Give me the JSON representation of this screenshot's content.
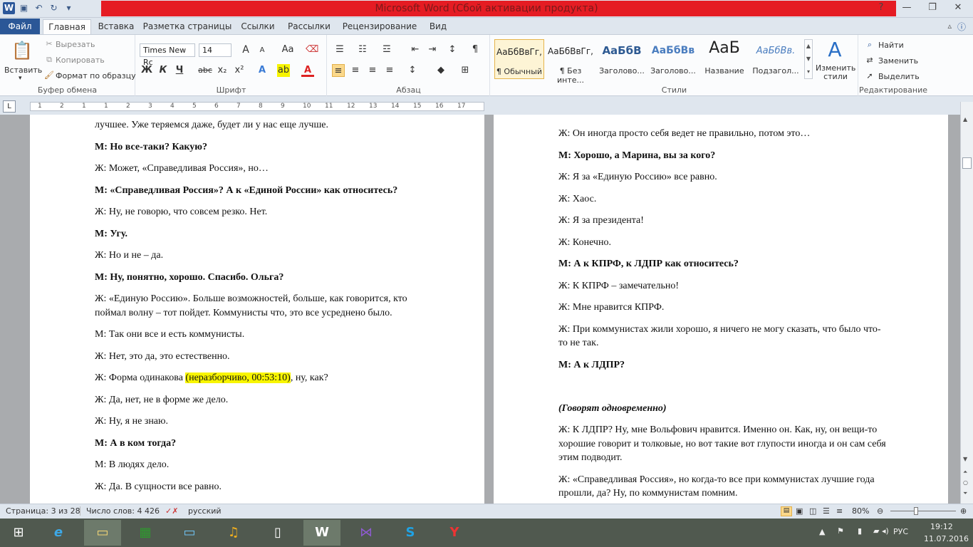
{
  "window": {
    "title": "Microsoft Word (Сбой активации продукта)"
  },
  "qat": {
    "word_icon": "W",
    "save_icon": "save-icon",
    "undo_icon": "undo-icon",
    "redo_icon": "redo-icon"
  },
  "tabs": [
    "Файл",
    "Главная",
    "Вставка",
    "Разметка страницы",
    "Ссылки",
    "Рассылки",
    "Рецензирование",
    "Вид"
  ],
  "clipboard": {
    "paste": "Вставить",
    "cut": "Вырезать",
    "copy": "Копировать",
    "format_painter": "Формат по образцу",
    "label": "Буфер обмена"
  },
  "font": {
    "name": "Times New Rc",
    "size": "14",
    "label": "Шрифт",
    "b": "Ж",
    "i": "К",
    "u": "Ч",
    "strike": "abc",
    "sub": "x₂",
    "sup": "x²",
    "aa": "Аа",
    "grow": "A",
    "shrink": "A"
  },
  "paragraph": {
    "label": "Абзац",
    "pilcrow": "¶"
  },
  "styles": {
    "label": "Стили",
    "items": [
      {
        "preview": "АаБбВвГг,",
        "name": "¶ Обычный"
      },
      {
        "preview": "АаБбВвГг,",
        "name": "¶ Без инте..."
      },
      {
        "preview": "АаБбВ",
        "name": "Заголово..."
      },
      {
        "preview": "АаБбВв",
        "name": "Заголово..."
      },
      {
        "preview": "АаБ",
        "name": "Название"
      },
      {
        "preview": "АаБбВв.",
        "name": "Подзагол..."
      }
    ],
    "change": "Изменить стили"
  },
  "editing": {
    "label": "Редактирование",
    "find": "Найти",
    "replace": "Заменить",
    "select": "Выделить"
  },
  "ruler": {
    "ticks": [
      "1",
      "2",
      "1",
      "1",
      "2",
      "3",
      "4",
      "5",
      "6",
      "7",
      "8",
      "9",
      "10",
      "11",
      "12",
      "13",
      "14",
      "15",
      "16",
      "17"
    ]
  },
  "page_left": {
    "lines": [
      {
        "t": "лучшее. Уже теряемся даже, будет ли у нас еще лучше.",
        "b": false
      },
      {
        "t": "М: Но все-таки? Какую?",
        "b": true
      },
      {
        "t": "Ж: Может, «Справедливая Россия», но…",
        "b": false
      },
      {
        "t": "М: «Справедливая Россия»? А к «Единой России» как относитесь?",
        "b": true
      },
      {
        "t": "Ж: Ну, не говорю, что совсем резко. Нет.",
        "b": false
      },
      {
        "t": "М: Угу.",
        "b": true
      },
      {
        "t": "Ж: Но и не – да.",
        "b": false
      },
      {
        "t": "М: Ну, понятно, хорошо. Спасибо. Ольга?",
        "b": true
      },
      {
        "t": "Ж: «Единую Россию». Больше возможностей, больше, как говорится, кто",
        "b": false
      },
      {
        "t": "поймал волну – тот пойдет. Коммунисты что, это все усреднено было.",
        "b": false
      },
      {
        "t": "М: Так они все и есть коммунисты.",
        "b": false
      },
      {
        "t": "Ж: Нет, это да, это естественно.",
        "b": false
      },
      {
        "t": "Ж: Да, нет, не в форме же дело.",
        "b": false
      },
      {
        "t": "Ж: Ну, я не знаю.",
        "b": false
      },
      {
        "t": "М: А в ком тогда?",
        "b": true
      },
      {
        "t": "М: В людях дело.",
        "b": false
      },
      {
        "t": "Ж: Да. В сущности все равно.",
        "b": false
      }
    ],
    "hl_line": {
      "before": "Ж: Форма одинакова ",
      "hl": "(неразборчиво, 00:53:10)",
      "after": ", ну, как?"
    }
  },
  "page_right": {
    "lines": [
      {
        "t": "Ж: Он иногда просто себя ведет не правильно, потом это…",
        "s": "n"
      },
      {
        "t": "М: Хорошо, а Марина, вы за кого?",
        "s": "b"
      },
      {
        "t": "Ж: Я за «Единую Россию» все равно.",
        "s": "n"
      },
      {
        "t": "Ж: Хаос.",
        "s": "n"
      },
      {
        "t": "Ж: Я за президента!",
        "s": "n"
      },
      {
        "t": "Ж: Конечно.",
        "s": "n"
      },
      {
        "t": "М: А к КПРФ, к ЛДПР как относитесь?",
        "s": "b"
      },
      {
        "t": "Ж: К КПРФ – замечательно!",
        "s": "n"
      },
      {
        "t": "Ж: Мне нравится КПРФ.",
        "s": "n"
      },
      {
        "t": "Ж: При коммунистах жили хорошо, я ничего не могу сказать, что было что-",
        "s": "n"
      },
      {
        "t": "то не так.",
        "s": "n"
      },
      {
        "t": "М: А к ЛДПР?",
        "s": "b"
      },
      {
        "t": "(Говорят одновременно)",
        "s": "bi"
      },
      {
        "t": "Ж: К ЛДПР? Ну, мне Вольфович нравится. Именно он. Как, ну, он вещи-то",
        "s": "n"
      },
      {
        "t": "хорошие говорит и толковые, но вот такие вот глупости иногда и он сам себя",
        "s": "n"
      },
      {
        "t": "этим подводит.",
        "s": "n"
      },
      {
        "t": "Ж: «Справедливая Россия», но когда-то все при коммунистах лучшие года",
        "s": "n"
      },
      {
        "t": "прошли, да? Ну, по коммунистам помним.",
        "s": "n"
      }
    ]
  },
  "status": {
    "page": "Страница: 3 из 28",
    "words": "Число слов: 4 426",
    "lang": "русский",
    "zoom": "80%"
  },
  "tray": {
    "lang": "РУС",
    "time": "19:12",
    "date": "11.07.2016"
  }
}
